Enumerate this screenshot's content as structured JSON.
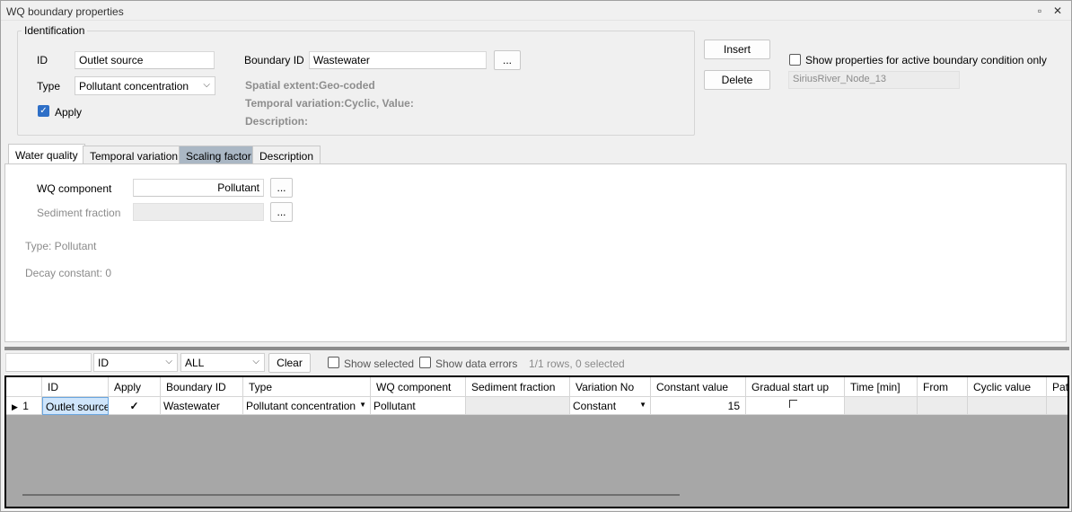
{
  "window": {
    "title": "WQ boundary properties"
  },
  "identification": {
    "group_label": "Identification",
    "id_label": "ID",
    "id_value": "Outlet source",
    "type_label": "Type",
    "type_value": "Pollutant concentration",
    "apply_label": "Apply",
    "apply_checked": true,
    "boundary_id_label": "Boundary ID",
    "boundary_id_value": "Wastewater",
    "browse_label": "...",
    "spatial_extent": "Spatial extent:Geo-coded",
    "temporal_variation": "Temporal variation:Cyclic, Value:",
    "description": "Description:"
  },
  "actions": {
    "insert_label": "Insert",
    "delete_label": "Delete",
    "show_active_label": "Show properties for active boundary condition only",
    "node_value": "SiriusRiver_Node_13"
  },
  "tabs": [
    {
      "label": "Water quality"
    },
    {
      "label": "Temporal variation"
    },
    {
      "label": "Scaling factor"
    },
    {
      "label": "Description"
    }
  ],
  "water_quality": {
    "wq_component_label": "WQ component",
    "wq_component_value": "Pollutant",
    "sediment_fraction_label": "Sediment fraction",
    "browse_label": "...",
    "type_text": "Type: Pollutant",
    "decay_text": "Decay constant: 0"
  },
  "filter_bar": {
    "search_value": "",
    "field_value": "ID",
    "scope_value": "ALL",
    "clear_label": "Clear",
    "show_selected_label": "Show selected",
    "show_errors_label": "Show data errors",
    "status": "1/1 rows, 0 selected"
  },
  "grid": {
    "columns": [
      "ID",
      "Apply",
      "Boundary ID",
      "Type",
      "WQ component",
      "Sediment fraction",
      "Variation No",
      "Constant value",
      "Gradual start up",
      "Time [min]",
      "From",
      "Cyclic value",
      "Patt"
    ],
    "rows": [
      {
        "row_num": "1",
        "id": "Outlet source",
        "apply": "✓",
        "boundary_id": "Wastewater",
        "type": "Pollutant concentration",
        "wq_component": "Pollutant",
        "sediment_fraction": "",
        "variation_no": "Constant",
        "constant_value": "15"
      }
    ]
  }
}
